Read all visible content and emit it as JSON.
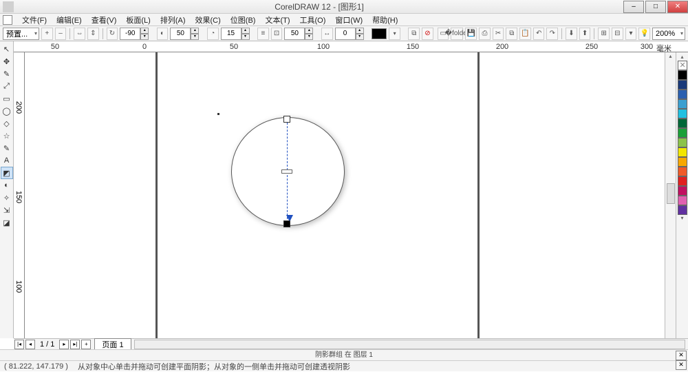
{
  "title": "CorelDRAW 12 - [图形1]",
  "menu": [
    "文件(F)",
    "编辑(E)",
    "查看(V)",
    "板面(L)",
    "排列(A)",
    "效果(C)",
    "位图(B)",
    "文本(T)",
    "工具(O)",
    "窗口(W)",
    "帮助(H)"
  ],
  "prop": {
    "preset": "预置...",
    "angle": "-90",
    "opacity": "50",
    "feather": "15",
    "fade": "50",
    "offset": "0",
    "zoom": "200%"
  },
  "ruler_h": [
    "50",
    "0",
    "50",
    "100",
    "150",
    "200",
    "250",
    "300",
    "毫米"
  ],
  "ruler_v": [
    "200",
    "150",
    "100"
  ],
  "nav": {
    "page_of": "1 / 1",
    "tab": "页面 1"
  },
  "status": {
    "line1": "阴影群组 在 图层 1",
    "coords": "( 81.222, 147.179 )",
    "hint": "从对象中心单击并拖动可创建平面阴影；从对象的一侧单击并拖动可创建透视阴影"
  },
  "palette": [
    "#ffffff",
    "#000000",
    "#1a3a7a",
    "#2a5fb0",
    "#3a9fd0",
    "#20c0e0",
    "#006838",
    "#1aa038",
    "#8bc34a",
    "#f2e600",
    "#f7a800",
    "#f05a28",
    "#e02020",
    "#c01060",
    "#e060b0",
    "#6030a0"
  ],
  "tool_glyphs": [
    "↖",
    "✥",
    "✎",
    "⤢",
    "▭",
    "◯",
    "◇",
    "☆",
    "✎",
    "A",
    "▦",
    "◩",
    "◐",
    "✧",
    "⇲"
  ],
  "btn_glyphs": {
    "plus": "+",
    "bars": "≡",
    "h": "⇔",
    "v": "⇕",
    "lock": "🔒",
    "rot": "↻",
    "cross": "✕",
    "nosym": "⊘",
    "doc": "▭",
    "copy": "⧉",
    "cut": "✂",
    "paste": "📋",
    "undo": "↶",
    "redo": "↷",
    "print": "⎙",
    "group": "⊞",
    "combine": "⊟",
    "bulb": "💡"
  }
}
